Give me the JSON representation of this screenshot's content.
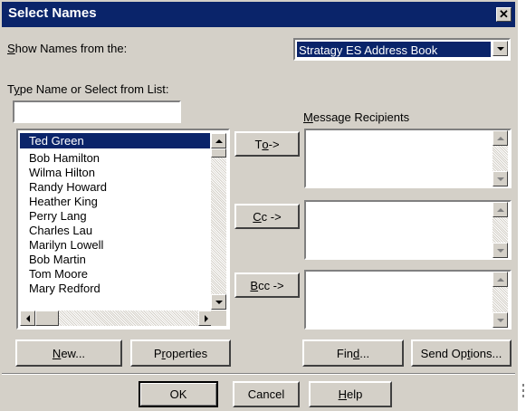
{
  "dialog": {
    "title": "Select Names",
    "close_glyph": "✕"
  },
  "show_names": {
    "label_prefix": "",
    "label_underline": "S",
    "label_rest": "how Names from the:",
    "selected_value": "Stratagy ES Address Book"
  },
  "type_name": {
    "label_prefix": "T",
    "label_underline": "y",
    "label_rest": "pe Name or Select from List:",
    "value": ""
  },
  "names_list": {
    "items": [
      "Ted Green",
      "Bob Hamilton",
      "Wilma Hilton",
      "Randy Howard",
      "Heather King",
      "Perry Lang",
      "Charles Lau",
      "Marilyn Lowell",
      "Bob Martin",
      "Tom Moore",
      "Mary Redford"
    ],
    "selected_index": 0
  },
  "recipients": {
    "label_underline": "M",
    "label_rest": "essage Recipients",
    "to_button": {
      "prefix": "T",
      "underline": "o",
      "suffix": " ->"
    },
    "cc_button": {
      "prefix": "",
      "underline": "C",
      "suffix": "c ->"
    },
    "bcc_button": {
      "prefix": "",
      "underline": "B",
      "suffix": "cc ->"
    }
  },
  "action_buttons": {
    "new": {
      "prefix": "",
      "underline": "N",
      "suffix": "ew..."
    },
    "properties": {
      "prefix": "P",
      "underline": "r",
      "suffix": "operties"
    },
    "find": {
      "prefix": "Fin",
      "underline": "d",
      "suffix": "..."
    },
    "send_options": {
      "prefix": "Send Op",
      "underline": "t",
      "suffix": "ions..."
    }
  },
  "footer": {
    "ok": "OK",
    "cancel": "Cancel",
    "help": {
      "prefix": "",
      "underline": "H",
      "suffix": "elp"
    }
  },
  "icons": {
    "scroll_up": "triangle-up",
    "scroll_down": "triangle-down",
    "scroll_left": "triangle-left",
    "scroll_right": "triangle-right",
    "combo_dropdown": "triangle-down"
  },
  "colors": {
    "titlebar": "#0a246a",
    "face": "#d4d0c8",
    "selection": "#0a246a"
  }
}
